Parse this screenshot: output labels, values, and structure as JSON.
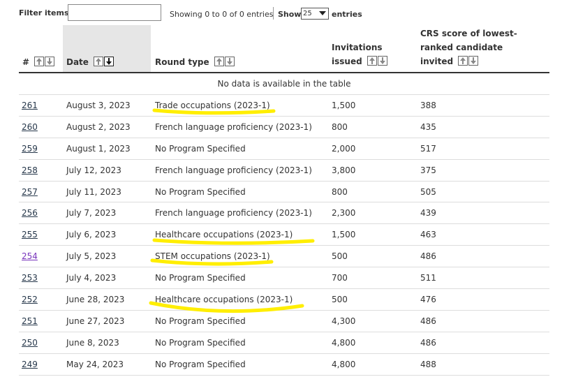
{
  "toolbar": {
    "filter_label": "Filter items",
    "filter_value": "",
    "showing_text": "Showing 0 to 0 of 0 entries",
    "show_label": "Show",
    "page_size": "25",
    "entries_label": "entries"
  },
  "table": {
    "headers": {
      "num": "#",
      "date": "Date",
      "round_type": "Round type",
      "invitations_l1": "Invitations",
      "invitations_l2": "issued",
      "crs_l1": "CRS score of lowest-",
      "crs_l2": "ranked candidate",
      "crs_l3": "invited"
    },
    "no_data_text": "No data is available in the table",
    "rows": [
      {
        "num": "261",
        "date": "August 3, 2023",
        "round_type": "Trade occupations (2023-1)",
        "invitations": "1,500",
        "crs": "388"
      },
      {
        "num": "260",
        "date": "August 2, 2023",
        "round_type": "French language proficiency (2023-1)",
        "invitations": "800",
        "crs": "435"
      },
      {
        "num": "259",
        "date": "August 1, 2023",
        "round_type": "No Program Specified",
        "invitations": "2,000",
        "crs": "517"
      },
      {
        "num": "258",
        "date": "July 12, 2023",
        "round_type": "French language proficiency (2023-1)",
        "invitations": "3,800",
        "crs": "375"
      },
      {
        "num": "257",
        "date": "July 11, 2023",
        "round_type": "No Program Specified",
        "invitations": "800",
        "crs": "505"
      },
      {
        "num": "256",
        "date": "July 7, 2023",
        "round_type": "French language proficiency (2023-1)",
        "invitations": "2,300",
        "crs": "439"
      },
      {
        "num": "255",
        "date": "July 6, 2023",
        "round_type": "Healthcare occupations (2023-1)",
        "invitations": "1,500",
        "crs": "463"
      },
      {
        "num": "254",
        "date": "July 5, 2023",
        "round_type": "STEM occupations (2023-1)",
        "invitations": "500",
        "crs": "486"
      },
      {
        "num": "253",
        "date": "July 4, 2023",
        "round_type": "No Program Specified",
        "invitations": "700",
        "crs": "511"
      },
      {
        "num": "252",
        "date": "June 28, 2023",
        "round_type": "Healthcare occupations (2023-1)",
        "invitations": "500",
        "crs": "476"
      },
      {
        "num": "251",
        "date": "June 27, 2023",
        "round_type": "No Program Specified",
        "invitations": "4,300",
        "crs": "486"
      },
      {
        "num": "250",
        "date": "June 8, 2023",
        "round_type": "No Program Specified",
        "invitations": "4,800",
        "crs": "486"
      },
      {
        "num": "249",
        "date": "May 24, 2023",
        "round_type": "No Program Specified",
        "invitations": "4,800",
        "crs": "488"
      }
    ]
  },
  "colors": {
    "link": "#26374a",
    "visited_link": "#7834bc",
    "highlighter": "#ffee00",
    "sorted_column_bg": "#e6e6e6"
  }
}
